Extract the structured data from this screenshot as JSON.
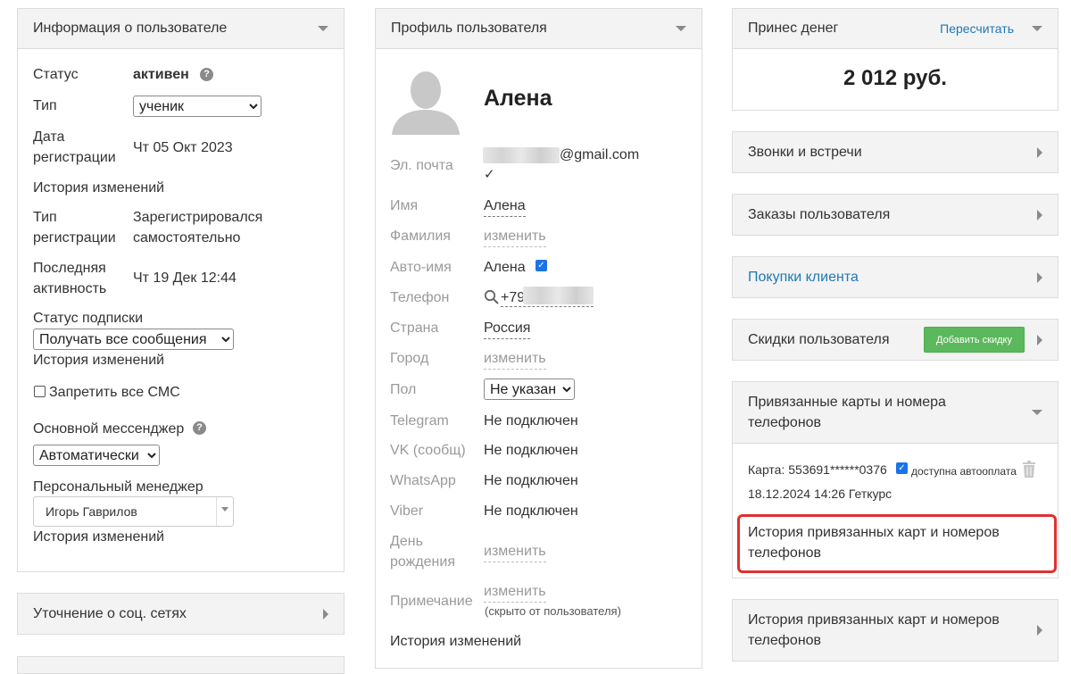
{
  "user_info": {
    "header": "Информация о пользователе",
    "status_label": "Статус",
    "status_value": "активен",
    "type_label": "Тип",
    "type_value": "ученик",
    "reg_date_label_1": "Дата",
    "reg_date_label_2": "регистрации",
    "reg_date_value": "Чт 05 Окт 2023",
    "history_link": "История изменений",
    "reg_type_label_1": "Тип",
    "reg_type_label_2": "регистрации",
    "reg_type_value_1": "Зарегистрировался",
    "reg_type_value_2": "самостоятельно",
    "last_activity_label_1": "Последняя",
    "last_activity_label_2": "активность",
    "last_activity_value": "Чт 19 Дек 12:44",
    "subscription_label": "Статус подписки",
    "subscription_value": "Получать все сообщения",
    "sms_ban_label": "Запретить все СМС",
    "messenger_label": "Основной мессенджер",
    "messenger_value": "Автоматически",
    "manager_label": "Персональный менеджер",
    "manager_value": "Игорь Гаврилов"
  },
  "social": {
    "header": "Уточнение о соц. сетях"
  },
  "profile": {
    "header": "Профиль пользователя",
    "name": "Алена",
    "email_label": "Эл. почта",
    "email_suffix": "@gmail.com",
    "email_check": "✓",
    "first_name_label": "Имя",
    "first_name_value": "Алена",
    "last_name_label": "Фамилия",
    "change": "изменить",
    "auto_name_label": "Авто-имя",
    "auto_name_value": "Алена",
    "phone_label": "Телефон",
    "phone_prefix": "+79",
    "country_label": "Страна",
    "country_value": "Россия",
    "city_label": "Город",
    "gender_label": "Пол",
    "gender_value": "Не указан",
    "telegram_label": "Telegram",
    "vk_label": "VK (сообщ)",
    "whatsapp_label": "WhatsApp",
    "viber_label": "Viber",
    "not_connected": "Не подключен",
    "birthday_label_1": "День",
    "birthday_label_2": "рождения",
    "note_label": "Примечание",
    "note_hint": "(скрыто от пользователя)",
    "history_link": "История изменений"
  },
  "money": {
    "header": "Принес денег",
    "recalc": "Пересчитать",
    "amount": "2 012 руб."
  },
  "calls": {
    "header": "Звонки и встречи"
  },
  "orders": {
    "header": "Заказы пользователя"
  },
  "purchases": {
    "header": "Покупки клиента"
  },
  "discounts": {
    "header": "Скидки пользователя",
    "add_button": "Добавить скидку"
  },
  "cards": {
    "header_1": "Привязанные карты и номера",
    "header_2": "телефонов",
    "card_text": "Карта: 553691******0376",
    "autopay": "доступна автооплата",
    "card_date": "18.12.2024 14:26 Геткурс",
    "history_link_1": "История привязанных карт и номеров",
    "history_link_2": "телефонов"
  },
  "cards_history": {
    "header_1": "История привязанных карт и номеров",
    "header_2": "телефонов"
  },
  "colors": {
    "link": "#1e78b4",
    "highlight": "#e03030",
    "add_button": "#5cb85c",
    "checkbox": "#1a73e8"
  }
}
